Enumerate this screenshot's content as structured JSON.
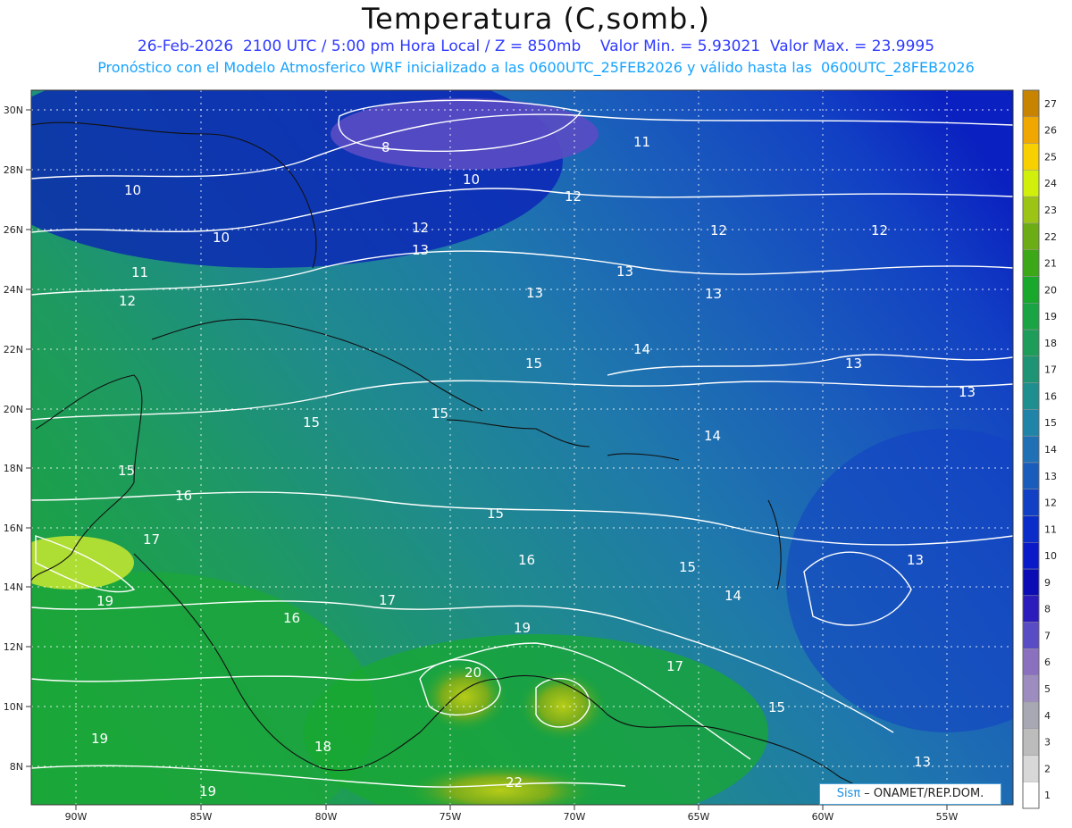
{
  "title": "Temperatura (C,somb.)",
  "subtitle1": "26-Feb-2026  2100 UTC / 5:00 pm Hora Local / Z = 850mb    Valor Min. = 5.93021  Valor Max. = 23.9995",
  "subtitle2": "Pronóstico con el Modelo Atmosferico WRF inicializado a las 0600UTC_25FEB2026 y válido hasta las  0600UTC_28FEB2026",
  "credit": {
    "brand": "Sisπ",
    "text": " – ONAMET/REP.DOM."
  },
  "axes": {
    "lon_labels": [
      "90W",
      "85W",
      "80W",
      "75W",
      "70W",
      "65W",
      "60W",
      "55W"
    ],
    "lat_labels": [
      "30N",
      "28N",
      "26N",
      "24N",
      "22N",
      "20N",
      "18N",
      "16N",
      "14N",
      "12N",
      "10N",
      "8N"
    ]
  },
  "colorbar": {
    "labels": [
      "1",
      "2",
      "3",
      "4",
      "5",
      "6",
      "7",
      "8",
      "9",
      "10",
      "11",
      "12",
      "13",
      "14",
      "15",
      "16",
      "17",
      "18",
      "19",
      "20",
      "21",
      "22",
      "23",
      "24",
      "25",
      "26",
      "27"
    ],
    "colors": [
      "#ffffff",
      "#d8d8d8",
      "#bcbcbc",
      "#a8a8b4",
      "#9c8cc0",
      "#8c70c0",
      "#5a4cc4",
      "#2c1cbc",
      "#0c0cb4",
      "#0a1ac8",
      "#0a2cc8",
      "#1240c4",
      "#1a5cbc",
      "#1f70b4",
      "#1f84a8",
      "#1f8e8e",
      "#1f9474",
      "#1e9c5a",
      "#1aa444",
      "#18a82c",
      "#3ca818",
      "#6cac14",
      "#9cc414",
      "#d0f00c",
      "#f8d000",
      "#f0a800",
      "#c88400"
    ]
  },
  "contour_labels": [
    "8",
    "10",
    "10",
    "10",
    "11",
    "11",
    "12",
    "12",
    "12",
    "12",
    "13",
    "13",
    "13",
    "13",
    "13",
    "13",
    "14",
    "14",
    "14",
    "15",
    "15",
    "15",
    "15",
    "15",
    "15",
    "16",
    "16",
    "16",
    "17",
    "17",
    "17",
    "18",
    "19",
    "19",
    "19",
    "19",
    "20",
    "22"
  ]
}
